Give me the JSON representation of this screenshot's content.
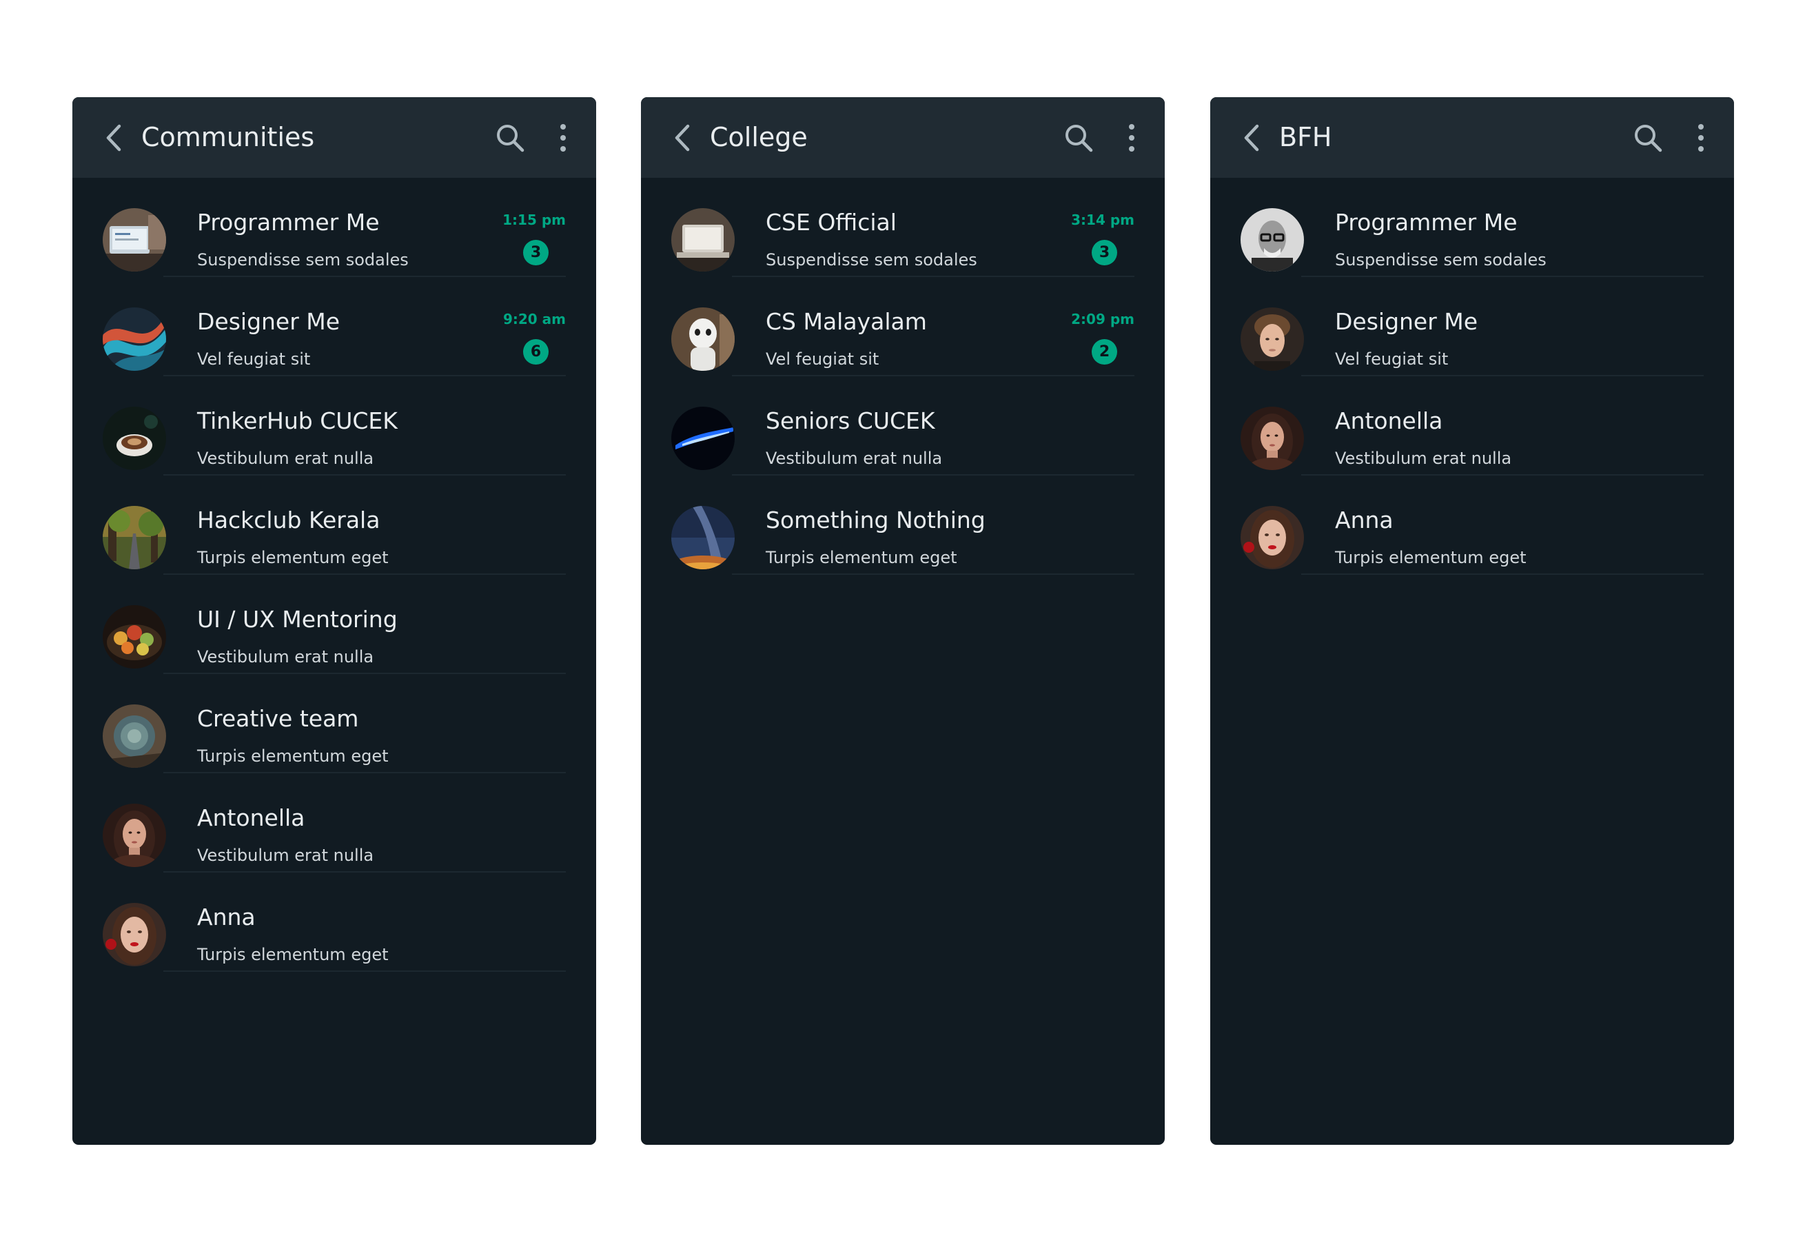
{
  "colors": {
    "page_background": "#ffffff",
    "panel_background": "#111b22",
    "header_background": "#202b33",
    "accent": "#00a884",
    "primary_text": "#e9edef",
    "secondary_text": "#d1d7db",
    "divider": "#1c2830"
  },
  "icons": {
    "back": "chevron-left-icon",
    "search": "search-icon",
    "menu": "more-vertical-icon"
  },
  "panels": [
    {
      "title": "Communities",
      "chats": [
        {
          "name": "Programmer Me",
          "preview": "Suspendisse sem sodales",
          "time": "1:15 pm",
          "unread": "3",
          "avatar": "laptop-desk-avatar"
        },
        {
          "name": "Designer Me",
          "preview": "Vel feugiat sit",
          "time": "9:20 am",
          "unread": "6",
          "avatar": "abstract-swirl-avatar"
        },
        {
          "name": "TinkerHub CUCEK",
          "preview": "Vestibulum erat nulla",
          "time": "",
          "unread": "",
          "avatar": "coffee-cup-avatar"
        },
        {
          "name": "Hackclub Kerala",
          "preview": "Turpis elementum eget",
          "time": "",
          "unread": "",
          "avatar": "forest-road-avatar"
        },
        {
          "name": "UI / UX Mentoring",
          "preview": "Vestibulum erat nulla",
          "time": "",
          "unread": "",
          "avatar": "flowers-avatar"
        },
        {
          "name": "Creative team",
          "preview": "Turpis elementum eget",
          "time": "",
          "unread": "",
          "avatar": "succulent-avatar"
        },
        {
          "name": "Antonella",
          "preview": "Vestibulum erat nulla",
          "time": "",
          "unread": "",
          "avatar": "woman-portrait-avatar"
        },
        {
          "name": "Anna",
          "preview": "Turpis elementum eget",
          "time": "",
          "unread": "",
          "avatar": "woman-red-lips-avatar"
        }
      ]
    },
    {
      "title": "College",
      "chats": [
        {
          "name": "CSE Official",
          "preview": "Suspendisse sem sodales",
          "time": "3:14 pm",
          "unread": "3",
          "avatar": "laptop-avatar"
        },
        {
          "name": "CS Malayalam",
          "preview": "Vel feugiat sit",
          "time": "2:09 pm",
          "unread": "2",
          "avatar": "robot-avatar"
        },
        {
          "name": "Seniors CUCEK",
          "preview": "Vestibulum erat nulla",
          "time": "",
          "unread": "",
          "avatar": "blue-light-avatar"
        },
        {
          "name": "Something Nothing",
          "preview": "Turpis elementum eget",
          "time": "",
          "unread": "",
          "avatar": "night-sky-avatar"
        }
      ]
    },
    {
      "title": "BFH",
      "chats": [
        {
          "name": "Programmer Me",
          "preview": "Suspendisse sem sodales",
          "time": "",
          "unread": "",
          "avatar": "man-glasses-avatar"
        },
        {
          "name": "Designer Me",
          "preview": "Vel feugiat sit",
          "time": "",
          "unread": "",
          "avatar": "young-man-avatar"
        },
        {
          "name": "Antonella",
          "preview": "Vestibulum erat nulla",
          "time": "",
          "unread": "",
          "avatar": "woman-portrait-avatar"
        },
        {
          "name": "Anna",
          "preview": "Turpis elementum eget",
          "time": "",
          "unread": "",
          "avatar": "woman-red-lips-avatar"
        }
      ]
    }
  ]
}
